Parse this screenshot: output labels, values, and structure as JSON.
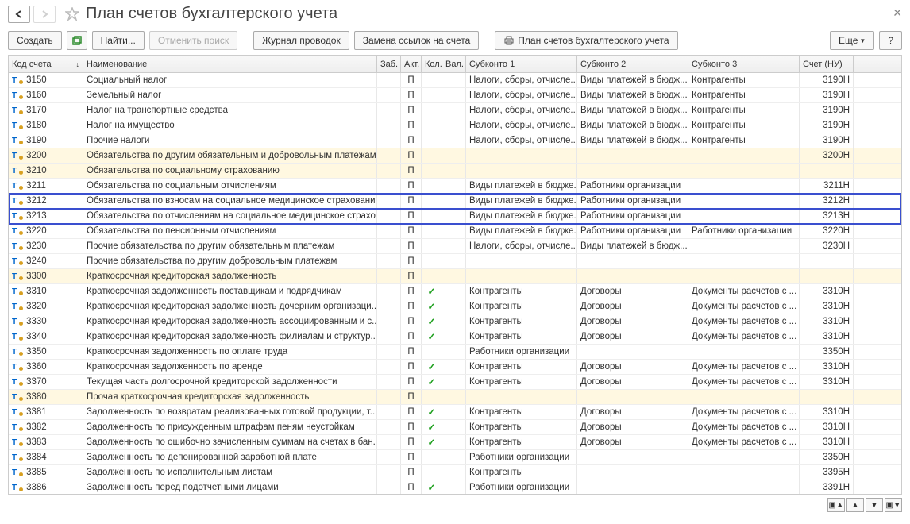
{
  "title": "План счетов бухгалтерского учета",
  "toolbar": {
    "create": "Создать",
    "find": "Найти...",
    "cancelSearch": "Отменить поиск",
    "journal": "Журнал проводок",
    "replace": "Замена ссылок на счета",
    "print": "План счетов бухгалтерского учета",
    "more": "Еще",
    "help": "?"
  },
  "columns": {
    "code": "Код счета",
    "name": "Наименование",
    "zab": "Заб.",
    "akt": "Акт.",
    "kol": "Кол.",
    "val": "Вал.",
    "sub1": "Субконто 1",
    "sub2": "Субконто 2",
    "sub3": "Субконто 3",
    "nu": "Счет (НУ)"
  },
  "rows": [
    {
      "code": "3150",
      "name": "Социальный налог",
      "akt": "П",
      "kol": "",
      "sub1": "Налоги, сборы, отчисле...",
      "sub2": "Виды платежей в бюдж...",
      "sub3": "Контрагенты",
      "nu": "3190Н",
      "group": false,
      "hl": false
    },
    {
      "code": "3160",
      "name": "Земельный налог",
      "akt": "П",
      "kol": "",
      "sub1": "Налоги, сборы, отчисле...",
      "sub2": "Виды платежей в бюдж...",
      "sub3": "Контрагенты",
      "nu": "3190Н",
      "group": false,
      "hl": false
    },
    {
      "code": "3170",
      "name": "Налог на транспортные средства",
      "akt": "П",
      "kol": "",
      "sub1": "Налоги, сборы, отчисле...",
      "sub2": "Виды платежей в бюдж...",
      "sub3": "Контрагенты",
      "nu": "3190Н",
      "group": false,
      "hl": false
    },
    {
      "code": "3180",
      "name": "Налог на имущество",
      "akt": "П",
      "kol": "",
      "sub1": "Налоги, сборы, отчисле...",
      "sub2": "Виды платежей в бюдж...",
      "sub3": "Контрагенты",
      "nu": "3190Н",
      "group": false,
      "hl": false
    },
    {
      "code": "3190",
      "name": "Прочие налоги",
      "akt": "П",
      "kol": "",
      "sub1": "Налоги, сборы, отчисле...",
      "sub2": "Виды платежей в бюдж...",
      "sub3": "Контрагенты",
      "nu": "3190Н",
      "group": false,
      "hl": false
    },
    {
      "code": "3200",
      "name": "Обязательства по другим обязательным и добровольным платежам",
      "akt": "П",
      "kol": "",
      "sub1": "",
      "sub2": "",
      "sub3": "",
      "nu": "3200Н",
      "group": true,
      "hl": false
    },
    {
      "code": "3210",
      "name": "Обязательства по социальному страхованию",
      "akt": "П",
      "kol": "",
      "sub1": "",
      "sub2": "",
      "sub3": "",
      "nu": "",
      "group": true,
      "hl": false
    },
    {
      "code": "3211",
      "name": "Обязательства по социальным отчислениям",
      "akt": "П",
      "kol": "",
      "sub1": "Виды платежей в бюдже...",
      "sub2": "Работники организации",
      "sub3": "",
      "nu": "3211Н",
      "group": false,
      "hl": false
    },
    {
      "code": "3212",
      "name": "Обязательства по взносам на социальное медицинское страхование",
      "akt": "П",
      "kol": "",
      "sub1": "Виды платежей в бюдже...",
      "sub2": "Работники организации",
      "sub3": "",
      "nu": "3212Н",
      "group": false,
      "hl": true
    },
    {
      "code": "3213",
      "name": "Обязательства по отчислениям на социальное медицинское страхо...",
      "akt": "П",
      "kol": "",
      "sub1": "Виды платежей в бюдже...",
      "sub2": "Работники организации",
      "sub3": "",
      "nu": "3213Н",
      "group": false,
      "hl": true
    },
    {
      "code": "3220",
      "name": "Обязательства по пенсионным отчислениям",
      "akt": "П",
      "kol": "",
      "sub1": "Виды платежей в бюдже...",
      "sub2": "Работники организации",
      "sub3": "Работники организации",
      "nu": "3220Н",
      "group": false,
      "hl": false
    },
    {
      "code": "3230",
      "name": "Прочие обязательства по другим обязательным платежам",
      "akt": "П",
      "kol": "",
      "sub1": "Налоги, сборы, отчисле...",
      "sub2": "Виды платежей в бюдж...",
      "sub3": "",
      "nu": "3230Н",
      "group": false,
      "hl": false
    },
    {
      "code": "3240",
      "name": "Прочие обязательства по другим добровольным платежам",
      "akt": "П",
      "kol": "",
      "sub1": "",
      "sub2": "",
      "sub3": "",
      "nu": "",
      "group": false,
      "hl": false
    },
    {
      "code": "3300",
      "name": "Краткосрочная кредиторская задолженность",
      "akt": "П",
      "kol": "",
      "sub1": "",
      "sub2": "",
      "sub3": "",
      "nu": "",
      "group": true,
      "hl": false
    },
    {
      "code": "3310",
      "name": "Краткосрочная задолженность поставщикам и подрядчикам",
      "akt": "П",
      "kol": "✓",
      "sub1": "Контрагенты",
      "sub2": "Договоры",
      "sub3": "Документы расчетов с ...",
      "nu": "3310Н",
      "group": false,
      "hl": false
    },
    {
      "code": "3320",
      "name": "Краткосрочная кредиторская задолженность дочерним организаци...",
      "akt": "П",
      "kol": "✓",
      "sub1": "Контрагенты",
      "sub2": "Договоры",
      "sub3": "Документы расчетов с ...",
      "nu": "3310Н",
      "group": false,
      "hl": false
    },
    {
      "code": "3330",
      "name": "Краткосрочная кредиторская задолженность ассоциированным и с...",
      "akt": "П",
      "kol": "✓",
      "sub1": "Контрагенты",
      "sub2": "Договоры",
      "sub3": "Документы расчетов с ...",
      "nu": "3310Н",
      "group": false,
      "hl": false
    },
    {
      "code": "3340",
      "name": "Краткосрочная кредиторская задолженность филиалам и структур...",
      "akt": "П",
      "kol": "✓",
      "sub1": "Контрагенты",
      "sub2": "Договоры",
      "sub3": "Документы расчетов с ...",
      "nu": "3310Н",
      "group": false,
      "hl": false
    },
    {
      "code": "3350",
      "name": "Краткосрочная задолженность по оплате труда",
      "akt": "П",
      "kol": "",
      "sub1": "Работники организации",
      "sub2": "",
      "sub3": "",
      "nu": "3350Н",
      "group": false,
      "hl": false
    },
    {
      "code": "3360",
      "name": "Краткосрочная задолженность по аренде",
      "akt": "П",
      "kol": "✓",
      "sub1": "Контрагенты",
      "sub2": "Договоры",
      "sub3": "Документы расчетов с ...",
      "nu": "3310Н",
      "group": false,
      "hl": false
    },
    {
      "code": "3370",
      "name": "Текущая часть долгосрочной кредиторской задолженности",
      "akt": "П",
      "kol": "✓",
      "sub1": "Контрагенты",
      "sub2": "Договоры",
      "sub3": "Документы расчетов с ...",
      "nu": "3310Н",
      "group": false,
      "hl": false
    },
    {
      "code": "3380",
      "name": "Прочая краткосрочная кредиторская задолженность",
      "akt": "П",
      "kol": "",
      "sub1": "",
      "sub2": "",
      "sub3": "",
      "nu": "",
      "group": true,
      "hl": false
    },
    {
      "code": "3381",
      "name": "Задолженность по возвратам реализованных готовой продукции, т...",
      "akt": "П",
      "kol": "✓",
      "sub1": "Контрагенты",
      "sub2": "Договоры",
      "sub3": "Документы расчетов с ...",
      "nu": "3310Н",
      "group": false,
      "hl": false
    },
    {
      "code": "3382",
      "name": "Задолженность по присужденным штрафам пеням неустойкам",
      "akt": "П",
      "kol": "✓",
      "sub1": "Контрагенты",
      "sub2": "Договоры",
      "sub3": "Документы расчетов с ...",
      "nu": "3310Н",
      "group": false,
      "hl": false
    },
    {
      "code": "3383",
      "name": "Задолженность по ошибочно зачисленным суммам на счетах в бан...",
      "akt": "П",
      "kol": "✓",
      "sub1": "Контрагенты",
      "sub2": "Договоры",
      "sub3": "Документы расчетов с ...",
      "nu": "3310Н",
      "group": false,
      "hl": false
    },
    {
      "code": "3384",
      "name": "Задолженность по депонированной заработной плате",
      "akt": "П",
      "kol": "",
      "sub1": "Работники организации",
      "sub2": "",
      "sub3": "",
      "nu": "3350Н",
      "group": false,
      "hl": false
    },
    {
      "code": "3385",
      "name": "Задолженность по исполнительным листам",
      "akt": "П",
      "kol": "",
      "sub1": "Контрагенты",
      "sub2": "",
      "sub3": "",
      "nu": "3395Н",
      "group": false,
      "hl": false
    },
    {
      "code": "3386",
      "name": "Задолженность перед подотчетными лицами",
      "akt": "П",
      "kol": "✓",
      "sub1": "Работники организации",
      "sub2": "",
      "sub3": "",
      "nu": "3391Н",
      "group": false,
      "hl": false
    }
  ]
}
